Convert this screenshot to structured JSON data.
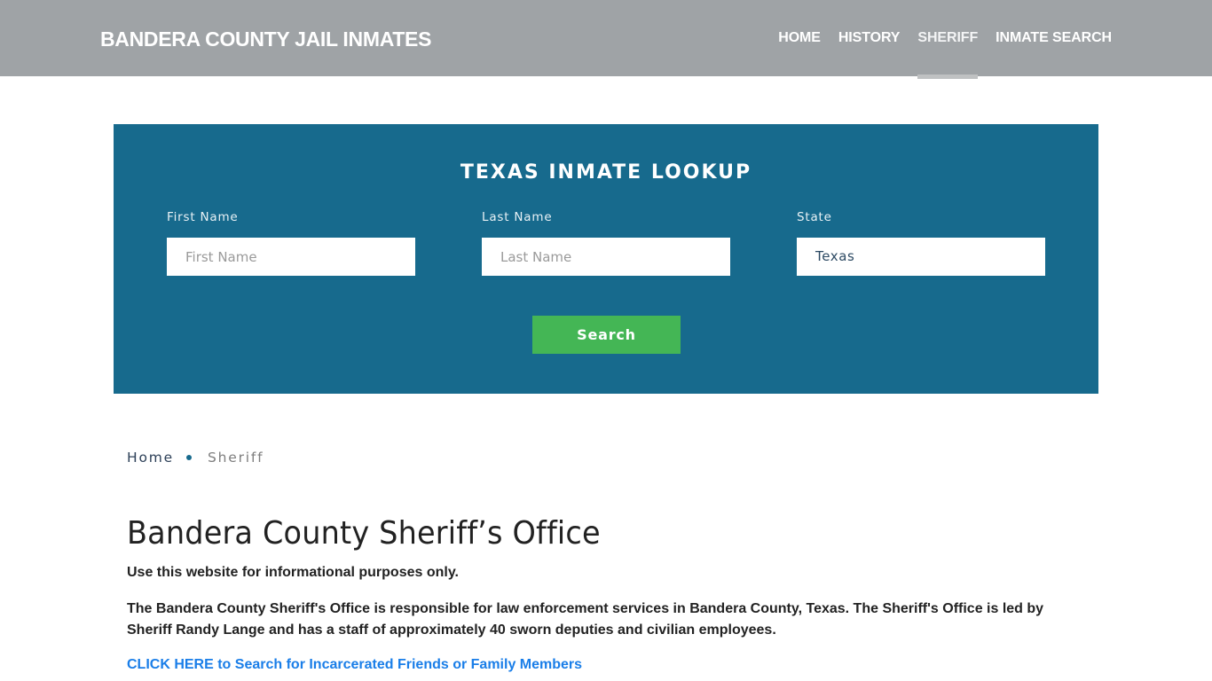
{
  "header": {
    "brand": "BANDERA COUNTY JAIL INMATES",
    "nav": [
      {
        "label": "HOME",
        "active": false
      },
      {
        "label": "HISTORY",
        "active": false
      },
      {
        "label": "SHERIFF",
        "active": true
      },
      {
        "label": "INMATE SEARCH",
        "active": false
      }
    ]
  },
  "lookup": {
    "title": "TEXAS INMATE LOOKUP",
    "first_name": {
      "label": "First Name",
      "placeholder": "First Name",
      "value": ""
    },
    "last_name": {
      "label": "Last Name",
      "placeholder": "Last Name",
      "value": ""
    },
    "state": {
      "label": "State",
      "value": "Texas"
    },
    "search_button": "Search"
  },
  "breadcrumb": {
    "home": "Home",
    "current": "Sheriff"
  },
  "main": {
    "title": "Bandera County Sheriff’s Office",
    "disclaimer": "Use this website for informational purposes only.",
    "description": "The Bandera County Sheriff's Office is responsible for law enforcement services in Bandera County, Texas. The Sheriff's Office is led by Sheriff Randy Lange and has a staff of approximately 40 sworn deputies and civilian employees.",
    "cta_link": "CLICK HERE to Search for Incarcerated Friends or Family Members"
  },
  "colors": {
    "header_bg": "#9fa3a6",
    "lookup_bg": "#176a8d",
    "search_button": "#44b655",
    "link": "#1a7ee8"
  }
}
